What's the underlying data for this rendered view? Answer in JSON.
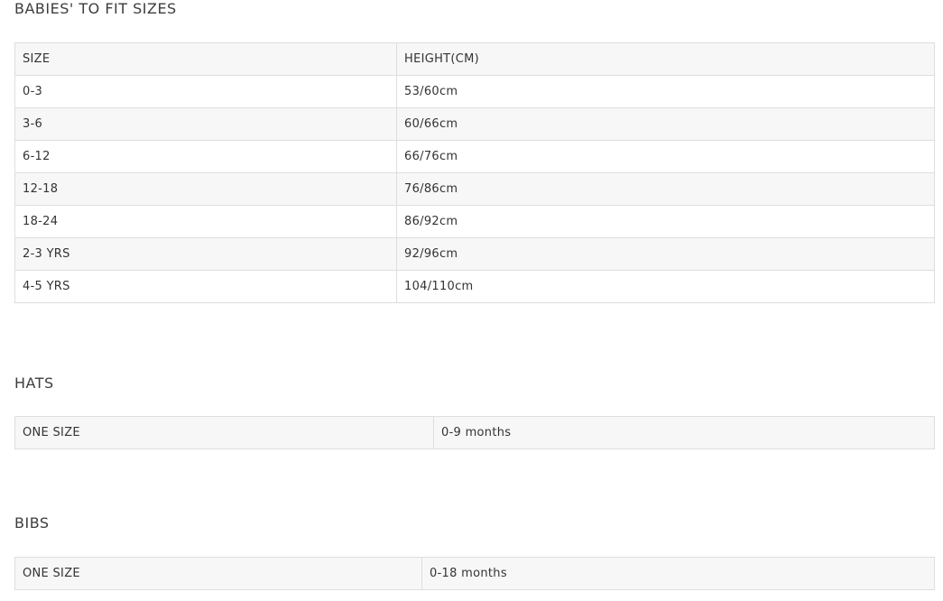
{
  "sections": {
    "babies": {
      "title": "BABIES' TO FIT SIZES",
      "rows": [
        [
          "SIZE",
          "HEIGHT(CM)"
        ],
        [
          "0-3",
          "53/60cm"
        ],
        [
          "3-6",
          "60/66cm"
        ],
        [
          "6-12",
          "66/76cm"
        ],
        [
          "12-18",
          "76/86cm"
        ],
        [
          "18-24",
          "86/92cm"
        ],
        [
          "2-3 YRS",
          "92/96cm"
        ],
        [
          "4-5 YRS",
          "104/110cm"
        ]
      ]
    },
    "hats": {
      "title": "HATS",
      "rows": [
        [
          "ONE SIZE",
          "0-9 months"
        ]
      ]
    },
    "bibs": {
      "title": "BIBS",
      "rows": [
        [
          "ONE SIZE",
          "0-18 months"
        ]
      ]
    }
  }
}
